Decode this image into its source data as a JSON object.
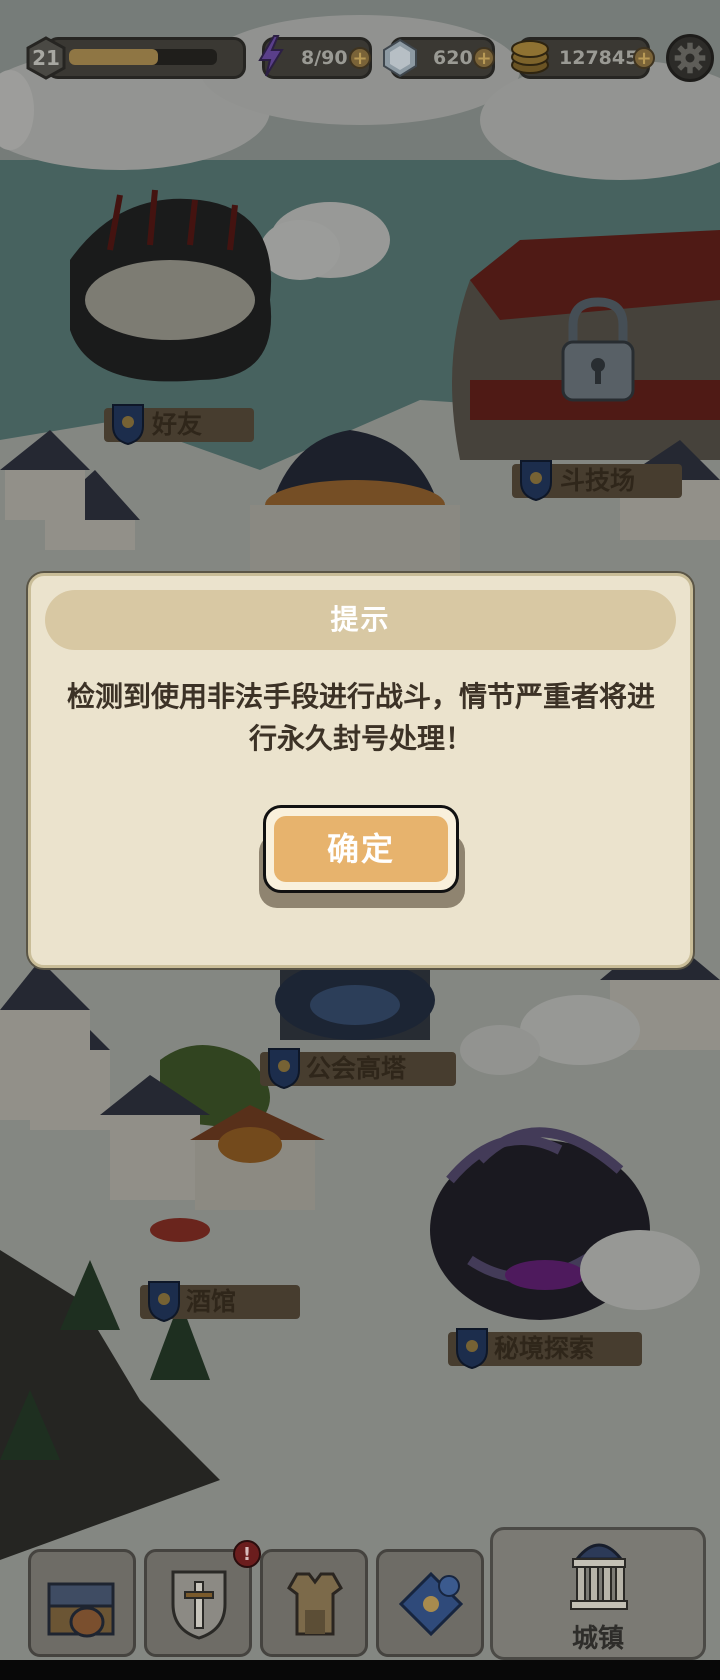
{
  "hud": {
    "level": "21",
    "level_progress": 0.6,
    "energy": "8/90",
    "gems": "620",
    "gold": "127845"
  },
  "map_labels": {
    "friends": "好友",
    "arena": "斗技场",
    "guild_tower": "公会高塔",
    "tavern": "酒馆",
    "secret_realm": "秘境探索"
  },
  "dialog": {
    "title": "提示",
    "message": "检测到使用非法手段进行战斗，情节严重者将进行永久封号处理！",
    "confirm_label": "确定"
  },
  "bottom_bar": {
    "notification_badge": "!",
    "town_label": "城镇"
  },
  "colors": {
    "dialog_bg": "#ebe3cd",
    "title_bar": "#d8c8a3",
    "confirm_button": "#e7b36d"
  },
  "icons": [
    "lightning-icon",
    "crystal-icon",
    "gold-coin-icon",
    "gear-icon",
    "lock-icon",
    "backpack-icon",
    "sword-shield-icon",
    "armor-icon",
    "map-scroll-icon",
    "town-hall-icon"
  ]
}
